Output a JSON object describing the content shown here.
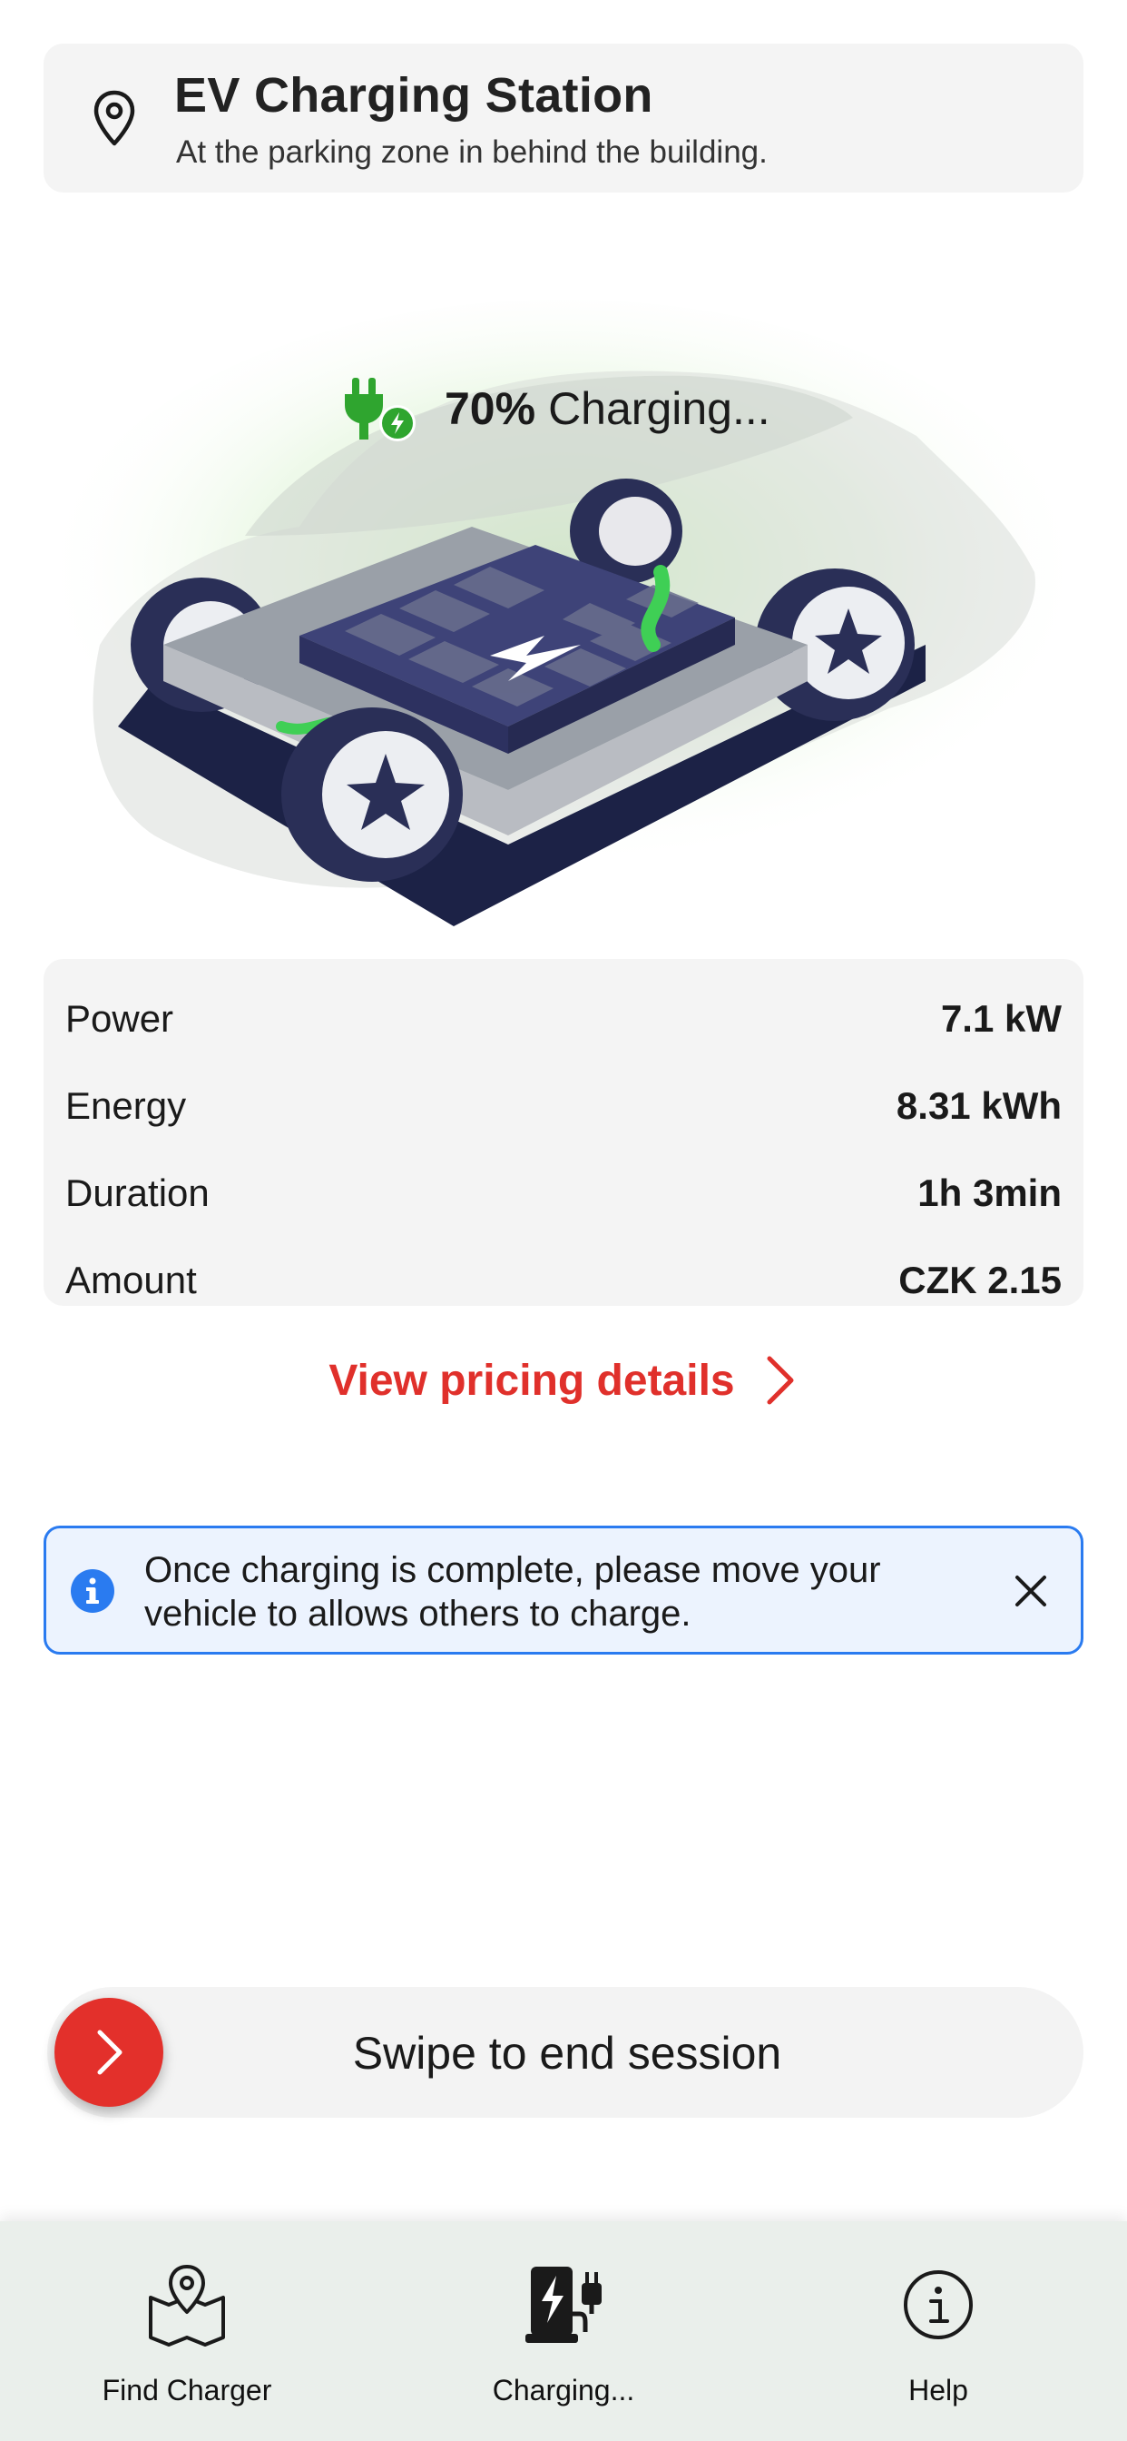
{
  "station": {
    "title": "EV Charging Station",
    "subtitle": "At the parking zone in behind the building."
  },
  "charging": {
    "percent": "70%",
    "status": "Charging...",
    "level": 0.7
  },
  "stats": [
    {
      "label": "Power",
      "value": "7.1 kW"
    },
    {
      "label": "Energy",
      "value": "8.31 kWh"
    },
    {
      "label": "Duration",
      "value": "1h 3min"
    },
    {
      "label": "Amount",
      "value": "CZK 2.15"
    }
  ],
  "pricing_link": "View pricing details",
  "info_banner": {
    "message": "Once charging is complete, please move your vehicle to allows others to charge."
  },
  "swipe": {
    "label": "Swipe to end session"
  },
  "tabs": [
    {
      "label": "Find Charger",
      "icon": "map-pin-icon"
    },
    {
      "label": "Charging...",
      "icon": "charging-station-icon"
    },
    {
      "label": "Help",
      "icon": "info-icon"
    }
  ],
  "colors": {
    "accent_red": "#e0302b",
    "charge_green": "#2fa52f",
    "info_blue": "#2a7bf0",
    "card_bg": "#f4f4f4",
    "tabbar_bg": "#eaefeb"
  }
}
